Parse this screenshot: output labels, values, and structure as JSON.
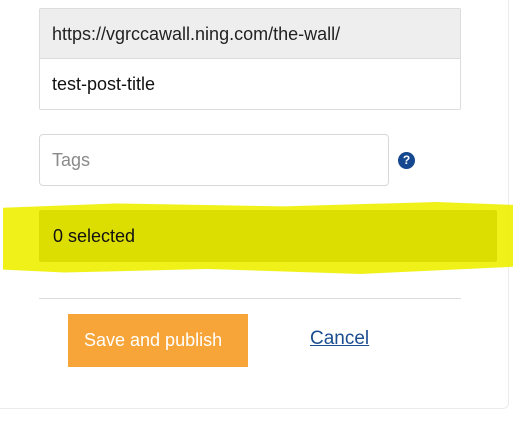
{
  "form": {
    "url_prefix": "https://vgrccawall.ning.com/the-wall/",
    "slug_value": "test-post-title",
    "tags_placeholder": "Tags",
    "help_icon": "question-mark-icon",
    "selected_text": "0 selected",
    "save_label": "Save and publish",
    "cancel_label": "Cancel"
  },
  "colors": {
    "highlight": "#eef000",
    "save_button": "#f7a538",
    "link": "#1a4d8f",
    "help_icon": "#15488f"
  }
}
